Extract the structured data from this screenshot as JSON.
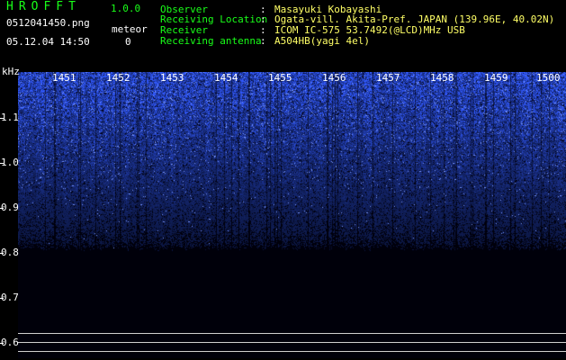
{
  "app": {
    "title": "HROFFT",
    "version": "1.0.0"
  },
  "file": {
    "name": "0512041450.png",
    "datetime": "05.12.04 14:50"
  },
  "meteor": {
    "label": "meteor",
    "count": "0"
  },
  "info": [
    {
      "label": "Observer",
      "value": "Masayuki Kobayashi"
    },
    {
      "label": "Receiving Location",
      "value": "Ogata-vill. Akita-Pref. JAPAN (139.96E, 40.02N)"
    },
    {
      "label": "Receiver",
      "value": "ICOM IC-575 53.7492(@LCD)MHz USB"
    },
    {
      "label": "Receiving antenna",
      "value": "A504HB(yagi 4el)"
    }
  ],
  "info_separator": ":",
  "axis": {
    "unit": "kHz",
    "y_labels": [
      "1.1",
      "1.0",
      "0.9",
      "0.8",
      "0.7",
      "0.6"
    ],
    "x_labels": [
      "1451",
      "1452",
      "1453",
      "1454",
      "1455",
      "1456",
      "1457",
      "1458",
      "1459",
      "1500"
    ]
  },
  "colors": {
    "header_text": "#19ff19",
    "value_text": "#ffff66",
    "signal": "#1f3cff",
    "background": "#000000"
  }
}
